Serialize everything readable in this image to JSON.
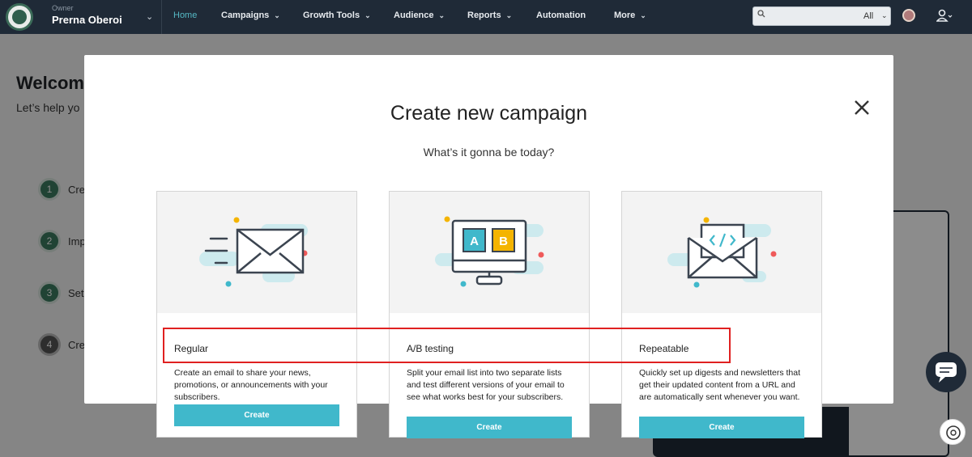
{
  "nav": {
    "owner_role": "Owner",
    "owner_name": "Prerna Oberoi",
    "items": [
      {
        "label": "Home",
        "active": true
      },
      {
        "label": "Campaigns",
        "chevron": true
      },
      {
        "label": "Growth Tools",
        "chevron": true
      },
      {
        "label": "Audience",
        "chevron": true
      },
      {
        "label": "Reports",
        "chevron": true
      },
      {
        "label": "Automation"
      },
      {
        "label": "More",
        "chevron": true
      }
    ],
    "search_scope": "All",
    "search_placeholder": ""
  },
  "background": {
    "title": "Welcom",
    "subtitle": "Let’s help yo",
    "steps": [
      {
        "num": "1",
        "text": "Cre"
      },
      {
        "num": "2",
        "text": "Imp"
      },
      {
        "num": "3",
        "text": "Set"
      },
      {
        "num": "4",
        "text": "Cre"
      }
    ]
  },
  "modal": {
    "title": "Create new campaign",
    "subtitle": "What’s it gonna be today?",
    "cards": [
      {
        "title": "Regular",
        "description": "Create an email to share your news, promotions, or announcements with your subscribers.",
        "button": "Create",
        "icon": "envelope-icon"
      },
      {
        "title": "A/B testing",
        "description": "Split your email list into two separate lists and test different versions of your email to see what works best for your subscribers.",
        "button": "Create",
        "icon": "ab-monitor-icon"
      },
      {
        "title": "Repeatable",
        "description": "Quickly set up digests and newsletters that get their updated content from a URL and are automatically sent whenever you want.",
        "button": "Create",
        "icon": "code-envelope-icon"
      }
    ],
    "ab_labels": [
      "A",
      "B"
    ]
  },
  "colors": {
    "nav_bg": "#1f2a37",
    "accent": "#40b8cb",
    "highlight": "#e02020"
  }
}
